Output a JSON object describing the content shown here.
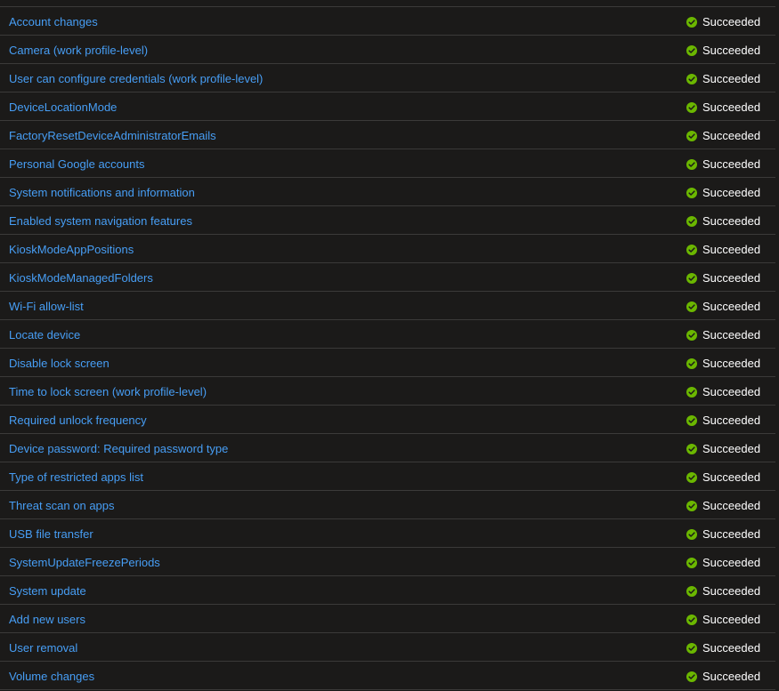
{
  "colors": {
    "background": "#1b1a19",
    "link": "#479ef5",
    "divider": "#3b3a39",
    "success": "#6bb700",
    "text": "#ffffff"
  },
  "status_icon": "check-circle-icon",
  "rows": [
    {
      "setting": "Account changes",
      "status": "Succeeded"
    },
    {
      "setting": "Camera (work profile-level)",
      "status": "Succeeded"
    },
    {
      "setting": "User can configure credentials (work profile-level)",
      "status": "Succeeded"
    },
    {
      "setting": "DeviceLocationMode",
      "status": "Succeeded"
    },
    {
      "setting": "FactoryResetDeviceAdministratorEmails",
      "status": "Succeeded"
    },
    {
      "setting": "Personal Google accounts",
      "status": "Succeeded"
    },
    {
      "setting": "System notifications and information",
      "status": "Succeeded"
    },
    {
      "setting": "Enabled system navigation features",
      "status": "Succeeded"
    },
    {
      "setting": "KioskModeAppPositions",
      "status": "Succeeded"
    },
    {
      "setting": "KioskModeManagedFolders",
      "status": "Succeeded"
    },
    {
      "setting": "Wi-Fi allow-list",
      "status": "Succeeded"
    },
    {
      "setting": "Locate device",
      "status": "Succeeded"
    },
    {
      "setting": "Disable lock screen",
      "status": "Succeeded"
    },
    {
      "setting": "Time to lock screen (work profile-level)",
      "status": "Succeeded"
    },
    {
      "setting": "Required unlock frequency",
      "status": "Succeeded"
    },
    {
      "setting": "Device password: Required password type",
      "status": "Succeeded"
    },
    {
      "setting": "Type of restricted apps list",
      "status": "Succeeded"
    },
    {
      "setting": "Threat scan on apps",
      "status": "Succeeded"
    },
    {
      "setting": "USB file transfer",
      "status": "Succeeded"
    },
    {
      "setting": "SystemUpdateFreezePeriods",
      "status": "Succeeded"
    },
    {
      "setting": "System update",
      "status": "Succeeded"
    },
    {
      "setting": "Add new users",
      "status": "Succeeded"
    },
    {
      "setting": "User removal",
      "status": "Succeeded"
    },
    {
      "setting": "Volume changes",
      "status": "Succeeded"
    }
  ]
}
